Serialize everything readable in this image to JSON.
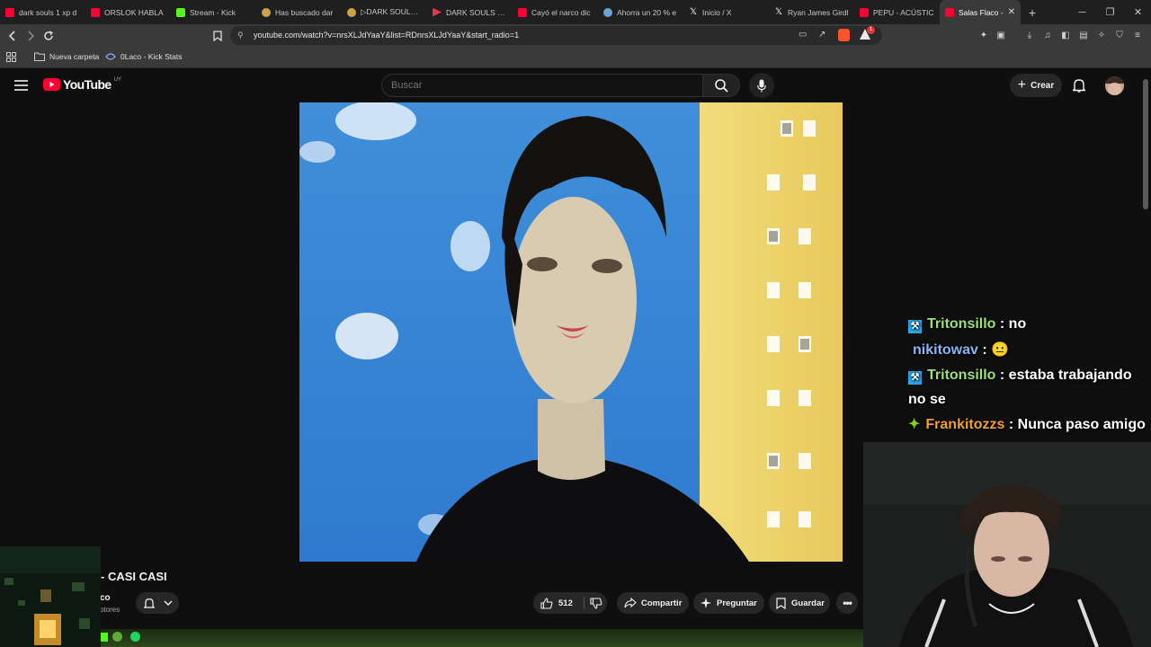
{
  "browser": {
    "tabs": [
      {
        "title": "dark souls 1 xp d",
        "favicon": "youtube-icon",
        "color": "#ff0033"
      },
      {
        "title": "ORSLOK HABLA",
        "favicon": "youtube-icon",
        "color": "#ff0033"
      },
      {
        "title": "Stream - Kick",
        "favicon": "kick-icon",
        "color": "#53fc18"
      },
      {
        "title": "Has buscado dar",
        "favicon": "page-icon",
        "color": "#c9a24a"
      },
      {
        "title": "▷DARK SOULS R",
        "favicon": "page-icon",
        "color": "#c9a24a"
      },
      {
        "title": "DARK SOULS RE",
        "favicon": "play-icon",
        "color": "#e0364f"
      },
      {
        "title": "Cayó el narco dic",
        "favicon": "youtube-icon",
        "color": "#ff0033"
      },
      {
        "title": "Ahorra un 20 % e",
        "favicon": "steam-icon",
        "color": "#6aa5d8"
      },
      {
        "title": "Inicio / X",
        "favicon": "x-icon",
        "color": "#ffffff"
      },
      {
        "title": "Ryan James Girdl",
        "favicon": "x-icon",
        "color": "#ffffff"
      },
      {
        "title": "PEPU - ACÚSTIC",
        "favicon": "youtube-icon",
        "color": "#ff0033"
      },
      {
        "title": "Salas Flaco -",
        "favicon": "youtube-icon",
        "color": "#ff0033",
        "active": true
      }
    ],
    "url": "youtube.com/watch?v=nrsXLJdYaaY&list=RDnrsXLJdYaaY&start_radio=1",
    "bookmarks": [
      {
        "label": "Nueva carpeta",
        "icon": "folder-icon"
      },
      {
        "label": "0Laco - Kick Stats",
        "icon": "link-icon"
      }
    ],
    "extension_badge": "1"
  },
  "youtube": {
    "logo_text": "YouTube",
    "region": "UY",
    "search_placeholder": "Buscar",
    "create_label": "Crear",
    "video_title": "- CASI CASI",
    "channel_name": "co",
    "subscribers_fragment": "otores",
    "like_count": "512",
    "share_label": "Compartir",
    "ask_label": "Preguntar",
    "save_label": "Guardar"
  },
  "chat": [
    {
      "user": "Tritonsillo",
      "message": "no",
      "user_color": "#9be07a",
      "badge": "pickaxe-badge"
    },
    {
      "user": "nikitowav",
      "message": "😐",
      "user_color": "#8ab4f8",
      "badge": ""
    },
    {
      "user": "Tritonsillo",
      "message": "estaba trabajando no se",
      "user_color": "#9be07a",
      "badge": "pickaxe-badge"
    },
    {
      "user": "Frankitozzs",
      "message": "Nunca paso amigo",
      "user_color": "#f0a030",
      "badge": "sparkle-badge"
    }
  ]
}
